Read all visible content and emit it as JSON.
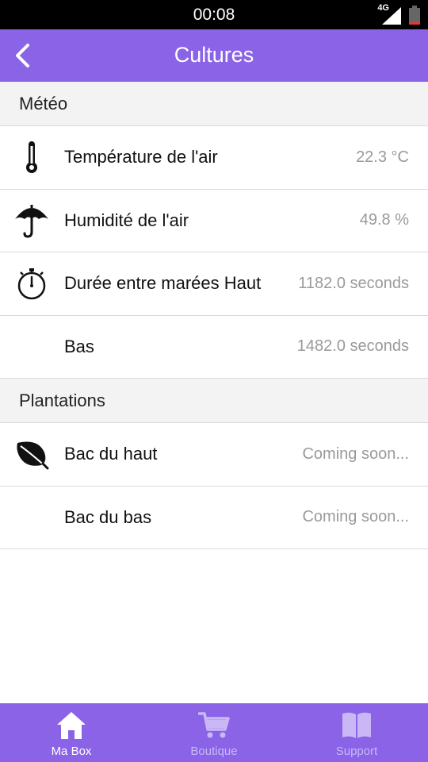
{
  "status_bar": {
    "time": "00:08",
    "network": "4G"
  },
  "app_bar": {
    "title": "Cultures"
  },
  "sections": [
    {
      "title": "Météo",
      "rows": [
        {
          "icon": "thermometer-icon",
          "label": "Température de l'air",
          "value": "22.3 °C"
        },
        {
          "icon": "umbrella-icon",
          "label": "Humidité de l'air",
          "value": "49.8 %"
        },
        {
          "icon": "stopwatch-icon",
          "label": "Durée entre marées Haut",
          "value": "1182.0 seconds"
        },
        {
          "icon": "",
          "label": "Bas",
          "value": "1482.0 seconds"
        }
      ]
    },
    {
      "title": "Plantations",
      "rows": [
        {
          "icon": "leaf-icon",
          "label": "Bac du haut",
          "value": "Coming soon..."
        },
        {
          "icon": "",
          "label": "Bac du bas",
          "value": "Coming soon..."
        }
      ]
    }
  ],
  "bottom_nav": [
    {
      "label": "Ma Box",
      "icon": "home-icon",
      "active": true
    },
    {
      "label": "Boutique",
      "icon": "cart-icon",
      "active": false
    },
    {
      "label": "Support",
      "icon": "book-icon",
      "active": false
    }
  ],
  "colors": {
    "primary": "#8a63e6",
    "nav_inactive": "#c9b8f5",
    "value_text": "#9a9a9a"
  }
}
